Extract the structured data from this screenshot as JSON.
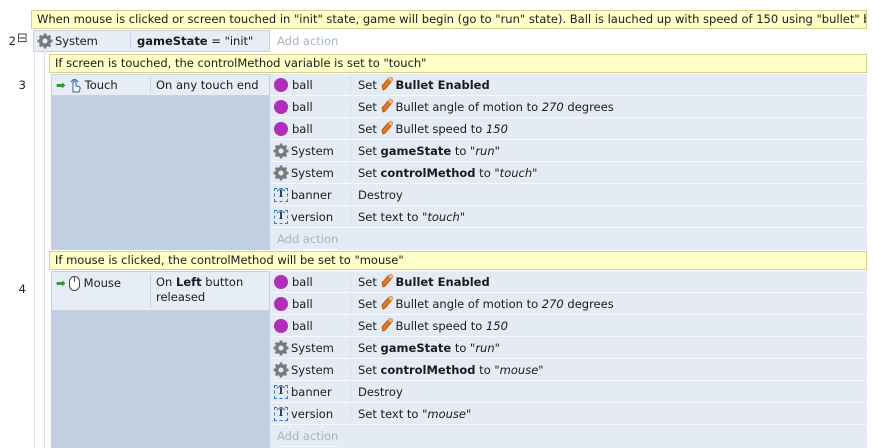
{
  "comments": {
    "c1": "When mouse is clicked or screen touched in \"init\" state, game will begin (go to \"run\" state). Ball is lauched up with speed of 150 using \"bullet\" behavior",
    "c2": "If screen is touched, the controlMethod variable is set to \"touch\"",
    "c3": "If mouse is clicked, the controlMethod will be set to \"mouse\""
  },
  "event2": {
    "line": "2",
    "collapse": "⊟",
    "object": "System",
    "condition_var": "gameState",
    "condition_rest": " = \"init\"",
    "add_action": "Add action"
  },
  "event3": {
    "line": "3",
    "object": "Touch",
    "condition": "On any touch end",
    "add_action": "Add action",
    "actions": [
      {
        "obj": "ball",
        "pre": "Set ",
        "b": "Bullet Enabled",
        "mid": "",
        "i": "",
        "post": ""
      },
      {
        "obj": "ball",
        "pre": "Set ",
        "b": "",
        "mid": "Bullet angle of motion to ",
        "i": "270",
        "post": " degrees"
      },
      {
        "obj": "ball",
        "pre": "Set ",
        "b": "",
        "mid": "Bullet speed to ",
        "i": "150",
        "post": ""
      },
      {
        "obj": "System",
        "pre": "Set ",
        "b": "gameState",
        "mid": " to ",
        "i": "\"run\"",
        "post": ""
      },
      {
        "obj": "System",
        "pre": "Set ",
        "b": "controlMethod",
        "mid": " to ",
        "i": "\"touch\"",
        "post": ""
      },
      {
        "obj": "banner",
        "pre": "Destroy",
        "b": "",
        "mid": "",
        "i": "",
        "post": ""
      },
      {
        "obj": "version",
        "pre": "Set text to ",
        "b": "",
        "mid": "",
        "i": "\"touch\"",
        "post": ""
      }
    ]
  },
  "event4": {
    "line": "4",
    "object": "Mouse",
    "condition_pre": "On ",
    "condition_b": "Left",
    "condition_post": " button released",
    "add_action": "Add action",
    "actions": [
      {
        "obj": "ball",
        "pre": "Set ",
        "b": "Bullet Enabled",
        "mid": "",
        "i": "",
        "post": ""
      },
      {
        "obj": "ball",
        "pre": "Set ",
        "b": "",
        "mid": "Bullet angle of motion to ",
        "i": "270",
        "post": " degrees"
      },
      {
        "obj": "ball",
        "pre": "Set ",
        "b": "",
        "mid": "Bullet speed to ",
        "i": "150",
        "post": ""
      },
      {
        "obj": "System",
        "pre": "Set ",
        "b": "gameState",
        "mid": " to ",
        "i": "\"run\"",
        "post": ""
      },
      {
        "obj": "System",
        "pre": "Set ",
        "b": "controlMethod",
        "mid": " to ",
        "i": "\"mouse\"",
        "post": ""
      },
      {
        "obj": "banner",
        "pre": "Destroy",
        "b": "",
        "mid": "",
        "i": "",
        "post": ""
      },
      {
        "obj": "version",
        "pre": "Set text to ",
        "b": "",
        "mid": "",
        "i": "\"mouse\"",
        "post": ""
      }
    ]
  },
  "icons": {
    "ball": "sprite-ball-icon",
    "System": "gear-icon",
    "banner": "text-object-icon",
    "version": "text-object-icon",
    "bullet": "bullet-behavior-icon"
  },
  "colors": {
    "comment_bg": "#ffffc8",
    "condition_bg": "#c2cfe0",
    "action_bg": "#e4ebf4",
    "sprite_purple": "#b02fb8"
  }
}
